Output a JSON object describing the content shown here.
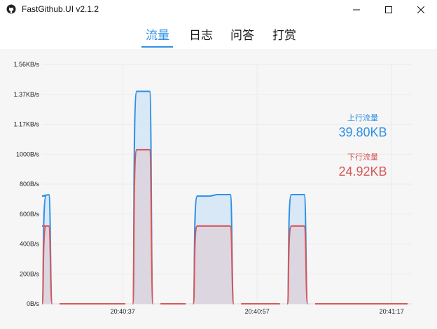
{
  "window": {
    "title": "FastGithub.UI v2.1.2",
    "icon": "github-icon",
    "controls": [
      "minimize-icon",
      "maximize-icon",
      "close-icon"
    ]
  },
  "tabs": [
    {
      "label": "流量",
      "active": true
    },
    {
      "label": "日志",
      "active": false
    },
    {
      "label": "问答",
      "active": false
    },
    {
      "label": "打赏",
      "active": false
    }
  ],
  "stats": {
    "upload": {
      "label": "上行流量",
      "value": "39.80KB"
    },
    "download": {
      "label": "下行流量",
      "value": "24.92KB"
    }
  },
  "colors": {
    "accent": "#2f90e6",
    "upload_line": "#2f90e6",
    "upload_fill": "#cfe3f5",
    "download_line": "#d85757",
    "download_fill": "#dcd0da",
    "chart_bg": "#f6f6f6"
  },
  "chart_data": {
    "type": "area",
    "grid": true,
    "y_ticks": [
      "0B/s",
      "200B/s",
      "400B/s",
      "600B/s",
      "800B/s",
      "1000B/s",
      "1.17KB/s",
      "1.37KB/s",
      "1.56KB/s"
    ],
    "ylim": [
      0,
      1600
    ],
    "x_ticks": [
      {
        "label": "20:40:37",
        "t": 12
      },
      {
        "label": "20:40:57",
        "t": 32
      },
      {
        "label": "20:41:17",
        "t": 52
      }
    ],
    "xlim": [
      0,
      55
    ],
    "x": [
      0,
      1,
      2,
      3,
      4,
      5,
      6,
      7,
      8,
      9,
      10,
      11,
      12,
      13,
      14,
      15,
      16,
      17,
      18,
      19,
      20,
      21,
      22,
      23,
      24,
      25,
      26,
      27,
      28,
      29,
      30,
      31,
      32,
      33,
      34,
      35,
      36,
      37,
      38,
      39,
      40,
      41,
      42,
      43,
      44,
      45,
      46,
      47,
      48,
      49,
      50,
      51,
      52,
      53,
      54,
      55
    ],
    "series": [
      {
        "name": "上行流量",
        "values": [
          720,
          730,
          0,
          0,
          0,
          0,
          0,
          0,
          0,
          0,
          0,
          0,
          0,
          0,
          1420,
          1420,
          1420,
          0,
          0,
          0,
          0,
          0,
          0,
          720,
          720,
          720,
          730,
          730,
          730,
          0,
          0,
          0,
          0,
          0,
          0,
          0,
          0,
          730,
          730,
          730,
          0,
          0,
          0,
          0,
          0,
          0,
          0,
          0,
          0,
          0,
          0,
          0,
          0,
          0,
          0,
          0
        ]
      },
      {
        "name": "下行流量",
        "values": [
          520,
          520,
          0,
          0,
          0,
          0,
          0,
          0,
          0,
          0,
          0,
          0,
          0,
          0,
          1030,
          1030,
          1030,
          0,
          0,
          0,
          0,
          0,
          0,
          520,
          520,
          520,
          520,
          520,
          520,
          0,
          0,
          0,
          0,
          0,
          0,
          0,
          0,
          520,
          520,
          520,
          0,
          0,
          0,
          0,
          0,
          0,
          0,
          0,
          0,
          0,
          0,
          0,
          0,
          0,
          0,
          0
        ]
      }
    ]
  }
}
